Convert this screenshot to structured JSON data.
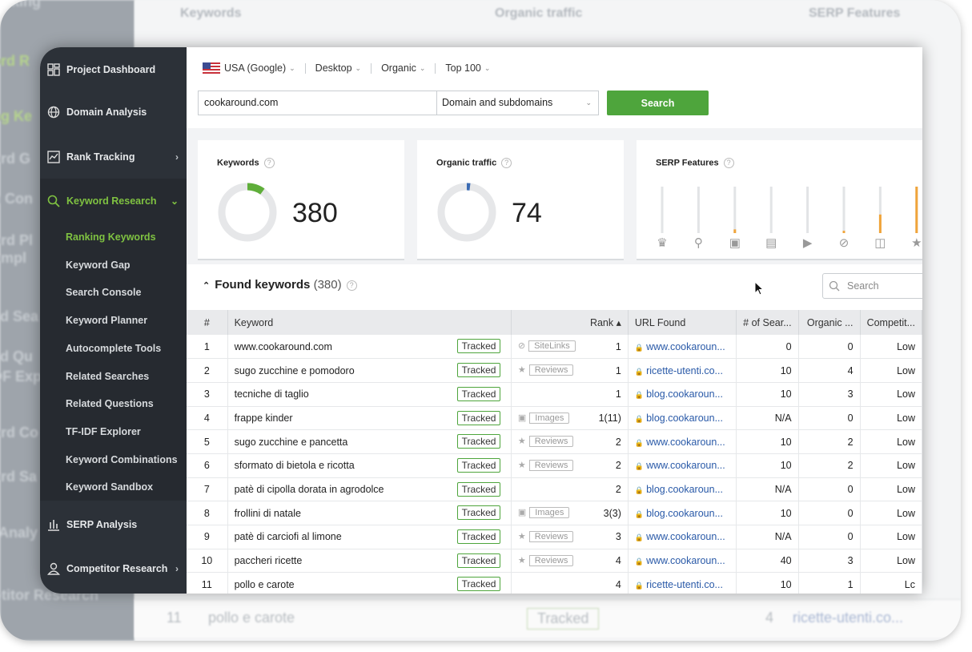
{
  "background": {
    "sidebar_fragments": [
      "acking",
      "ord R",
      "ng Ke",
      "ord G",
      "n Con",
      "ord Pl",
      "ompl",
      "ed Sea",
      "ed Qu",
      "DF Exp",
      "ord Co",
      "ord Sa",
      "Analy",
      "etitor Research"
    ],
    "top_labels": [
      "Keywords",
      "Organic traffic",
      "SERP Features"
    ],
    "bottom_row": {
      "num": "11",
      "keyword": "pollo e carote",
      "tracked": "Tracked",
      "rank": "4",
      "url": "ricette-utenti.co..."
    }
  },
  "sidebar": {
    "items": [
      {
        "label": "Project Dashboard",
        "icon": "dashboard-icon"
      },
      {
        "label": "Domain Analysis",
        "icon": "globe-icon"
      },
      {
        "label": "Rank Tracking",
        "icon": "chart-line-icon"
      },
      {
        "label": "Keyword Research",
        "icon": "search-icon"
      },
      {
        "label": "SERP Analysis",
        "icon": "bar-chart-icon"
      },
      {
        "label": "Competitor Research",
        "icon": "user-icon"
      }
    ],
    "sub_items": [
      "Ranking Keywords",
      "Keyword Gap",
      "Search Console",
      "Keyword Planner",
      "Autocomplete Tools",
      "Related Searches",
      "Related Questions",
      "TF-IDF Explorer",
      "Keyword Combinations",
      "Keyword Sandbox"
    ]
  },
  "toolbar": {
    "country": "USA (Google)",
    "device": "Desktop",
    "type": "Organic",
    "depth": "Top 100",
    "domain": "cookaround.com",
    "mode": "Domain and subdomains",
    "search_button": "Search"
  },
  "stats": {
    "keywords": {
      "label": "Keywords",
      "value": "380",
      "fraction": 0.1
    },
    "traffic": {
      "label": "Organic traffic",
      "value": "74",
      "fraction": 0.02
    },
    "serp": {
      "label": "SERP Features",
      "levels": [
        0,
        0,
        0.08,
        0,
        0,
        0.05,
        0.4,
        1
      ],
      "icons": [
        "crown-icon",
        "map-pin-icon",
        "image-icon",
        "news-icon",
        "video-icon",
        "sitelinks-icon",
        "snippet-icon",
        "star-icon"
      ]
    }
  },
  "found": {
    "title": "Found keywords",
    "count": "(380)",
    "search_placeholder": "Search"
  },
  "table": {
    "headers": [
      "#",
      "Keyword",
      "Rank",
      "URL Found",
      "# of Sear...",
      "Organic ...",
      "Competit..."
    ],
    "rows": [
      {
        "n": "1",
        "kw": "www.cookaround.com",
        "tracked": "Tracked",
        "feat_icon": "sitelinks-icon",
        "feat": "SiteLinks",
        "rank": "1",
        "url": "www.cookaroun...",
        "vol": "0",
        "org": "0",
        "comp": "Low"
      },
      {
        "n": "2",
        "kw": "sugo zucchine e pomodoro",
        "tracked": "Tracked",
        "feat_icon": "star-icon",
        "feat": "Reviews",
        "rank": "1",
        "url": "ricette-utenti.co...",
        "vol": "10",
        "org": "4",
        "comp": "Low"
      },
      {
        "n": "3",
        "kw": "tecniche di taglio",
        "tracked": "Tracked",
        "feat_icon": "",
        "feat": "",
        "rank": "1",
        "url": "blog.cookaroun...",
        "vol": "10",
        "org": "3",
        "comp": "Low"
      },
      {
        "n": "4",
        "kw": "frappe kinder",
        "tracked": "Tracked",
        "feat_icon": "image-icon",
        "feat": "Images",
        "rank": "1(11)",
        "url": "blog.cookaroun...",
        "vol": "N/A",
        "org": "0",
        "comp": "Low"
      },
      {
        "n": "5",
        "kw": "sugo zucchine e pancetta",
        "tracked": "Tracked",
        "feat_icon": "star-icon",
        "feat": "Reviews",
        "rank": "2",
        "url": "www.cookaroun...",
        "vol": "10",
        "org": "2",
        "comp": "Low"
      },
      {
        "n": "6",
        "kw": "sformato di bietola e ricotta",
        "tracked": "Tracked",
        "feat_icon": "star-icon",
        "feat": "Reviews",
        "rank": "2",
        "url": "www.cookaroun...",
        "vol": "10",
        "org": "2",
        "comp": "Low"
      },
      {
        "n": "7",
        "kw": "patè di cipolla dorata in agrodolce",
        "tracked": "Tracked",
        "feat_icon": "",
        "feat": "",
        "rank": "2",
        "url": "blog.cookaroun...",
        "vol": "N/A",
        "org": "0",
        "comp": "Low"
      },
      {
        "n": "8",
        "kw": "frollini di natale",
        "tracked": "Tracked",
        "feat_icon": "image-icon",
        "feat": "Images",
        "rank": "3(3)",
        "url": "blog.cookaroun...",
        "vol": "10",
        "org": "0",
        "comp": "Low"
      },
      {
        "n": "9",
        "kw": "patè di carciofi al limone",
        "tracked": "Tracked",
        "feat_icon": "star-icon",
        "feat": "Reviews",
        "rank": "3",
        "url": "www.cookaroun...",
        "vol": "N/A",
        "org": "0",
        "comp": "Low"
      },
      {
        "n": "10",
        "kw": "paccheri ricette",
        "tracked": "Tracked",
        "feat_icon": "star-icon",
        "feat": "Reviews",
        "rank": "4",
        "url": "www.cookaroun...",
        "vol": "40",
        "org": "3",
        "comp": "Low"
      },
      {
        "n": "11",
        "kw": "pollo e carote",
        "tracked": "Tracked",
        "feat_icon": "",
        "feat": "",
        "rank": "4",
        "url": "ricette-utenti.co...",
        "vol": "10",
        "org": "1",
        "comp": "Lc"
      }
    ]
  },
  "colors": {
    "accent": "#7fc241",
    "button": "#4ea53c",
    "sidebar": "#2c3138",
    "link": "#2a5aa8",
    "serp_bar": "#f0a43a"
  }
}
